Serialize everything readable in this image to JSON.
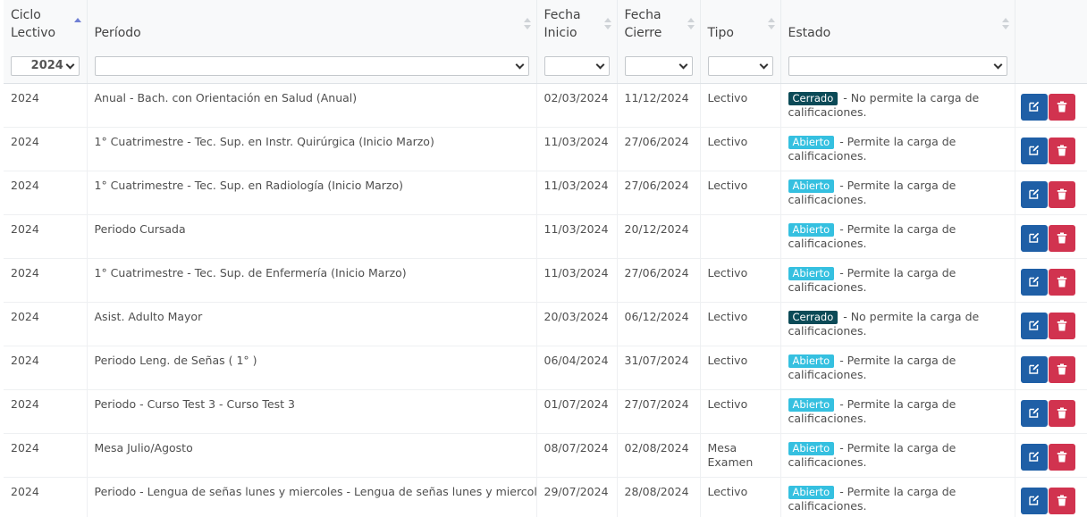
{
  "headers": {
    "ciclo": [
      "Ciclo",
      "Lectivo"
    ],
    "periodo": "Período",
    "inicio": [
      "Fecha",
      "Inicio"
    ],
    "cierre": [
      "Fecha",
      "Cierre"
    ],
    "tipo": "Tipo",
    "estado": "Estado"
  },
  "filters": {
    "ciclo": "2024",
    "periodo": "",
    "inicio": "",
    "cierre": "",
    "tipo": "",
    "estado": ""
  },
  "status_text": {
    "closed_badge": "Cerrado",
    "closed_desc": "- No permite la carga de calificaciones.",
    "open_badge": "Abierto",
    "open_desc": "- Permite la carga de calificaciones."
  },
  "colors": {
    "closed": "#0b4a57",
    "open": "#35c0e0",
    "edit": "#1f5fa6",
    "delete": "#d1334f"
  },
  "icons": {
    "edit": "edit-icon",
    "delete": "trash-icon",
    "sort": "sort-icon",
    "dropdown": "chevron-down-icon"
  },
  "rows": [
    {
      "ciclo": "2024",
      "periodo": "Anual - Bach. con Orientación en Salud (Anual)",
      "inicio": "02/03/2024",
      "cierre": "11/12/2024",
      "tipo": "Lectivo",
      "estado": "closed"
    },
    {
      "ciclo": "2024",
      "periodo": "1° Cuatrimestre - Tec. Sup. en Instr. Quirúrgica (Inicio Marzo)",
      "inicio": "11/03/2024",
      "cierre": "27/06/2024",
      "tipo": "Lectivo",
      "estado": "open"
    },
    {
      "ciclo": "2024",
      "periodo": "1° Cuatrimestre - Tec. Sup. en Radiología (Inicio Marzo)",
      "inicio": "11/03/2024",
      "cierre": "27/06/2024",
      "tipo": "Lectivo",
      "estado": "open"
    },
    {
      "ciclo": "2024",
      "periodo": "Periodo Cursada",
      "inicio": "11/03/2024",
      "cierre": "20/12/2024",
      "tipo": "",
      "estado": "open"
    },
    {
      "ciclo": "2024",
      "periodo": "1° Cuatrimestre - Tec. Sup. de Enfermería (Inicio Marzo)",
      "inicio": "11/03/2024",
      "cierre": "27/06/2024",
      "tipo": "Lectivo",
      "estado": "open"
    },
    {
      "ciclo": "2024",
      "periodo": "Asist. Adulto Mayor",
      "inicio": "20/03/2024",
      "cierre": "06/12/2024",
      "tipo": "Lectivo",
      "estado": "closed"
    },
    {
      "ciclo": "2024",
      "periodo": "Periodo Leng. de Señas ( 1° )",
      "inicio": "06/04/2024",
      "cierre": "31/07/2024",
      "tipo": "Lectivo",
      "estado": "open"
    },
    {
      "ciclo": "2024",
      "periodo": "Periodo - Curso Test 3 - Curso Test 3",
      "inicio": "01/07/2024",
      "cierre": "27/07/2024",
      "tipo": "Lectivo",
      "estado": "open"
    },
    {
      "ciclo": "2024",
      "periodo": "Mesa Julio/Agosto",
      "inicio": "08/07/2024",
      "cierre": "02/08/2024",
      "tipo": "Mesa Examen",
      "estado": "open"
    },
    {
      "ciclo": "2024",
      "periodo": "Periodo - Lengua de señas lunes y miercoles - Lengua de señas lunes y miercoles",
      "inicio": "29/07/2024",
      "cierre": "28/08/2024",
      "tipo": "Lectivo",
      "estado": "open"
    }
  ]
}
